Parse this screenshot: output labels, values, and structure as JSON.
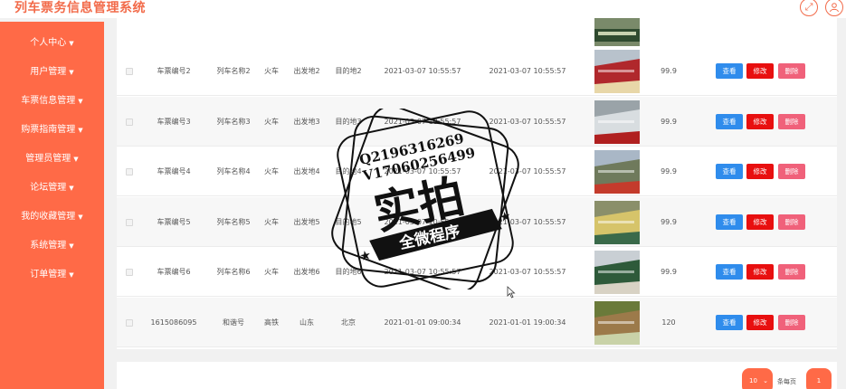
{
  "app": {
    "title": "列车票务信息管理系统"
  },
  "topbar_icons": [
    "fullscreen-icon",
    "user-icon"
  ],
  "sidebar": {
    "items": [
      {
        "label": "个人中心"
      },
      {
        "label": "用户管理"
      },
      {
        "label": "车票信息管理"
      },
      {
        "label": "购票指南管理"
      },
      {
        "label": "管理员管理"
      },
      {
        "label": "论坛管理"
      },
      {
        "label": "我的收藏管理"
      },
      {
        "label": "系统管理"
      },
      {
        "label": "订单管理"
      }
    ],
    "caret": "▼"
  },
  "table": {
    "rows": [
      {
        "code": "车票编号2",
        "name": "列车名称2",
        "type": "火车",
        "from": "出发地2",
        "to": "目的地2",
        "depart": "2021-03-07 10:55:57",
        "arrive": "2021-03-07 10:55:57",
        "price": "99.9"
      },
      {
        "code": "车票编号3",
        "name": "列车名称3",
        "type": "火车",
        "from": "出发地3",
        "to": "目的地3",
        "depart": "2021-03-07 10:55:57",
        "arrive": "2021-03-07 10:55:57",
        "price": "99.9"
      },
      {
        "code": "车票编号4",
        "name": "列车名称4",
        "type": "火车",
        "from": "出发地4",
        "to": "目的地4",
        "depart": "2021-03-07 10:55:57",
        "arrive": "2021-03-07 10:55:57",
        "price": "99.9"
      },
      {
        "code": "车票编号5",
        "name": "列车名称5",
        "type": "火车",
        "from": "出发地5",
        "to": "目的地5",
        "depart": "2021-03-07 10:55:57",
        "arrive": "2021-03-07 10:55:57",
        "price": "99.9"
      },
      {
        "code": "车票编号6",
        "name": "列车名称6",
        "type": "火车",
        "from": "出发地6",
        "to": "目的地6",
        "depart": "2021-03-07 10:55:57",
        "arrive": "2021-03-07 10:55:57",
        "price": "99.9"
      },
      {
        "code": "1615086095",
        "name": "和谐号",
        "type": "高铁",
        "from": "山东",
        "to": "北京",
        "depart": "2021-01-01 09:00:34",
        "arrive": "2021-01-01 19:00:34",
        "price": "120"
      }
    ],
    "actions": {
      "view": "查看",
      "edit": "修改",
      "delete": "删除"
    }
  },
  "pagination": {
    "page_size": "10",
    "page_size_label": "条每页",
    "current_page": "1"
  },
  "watermark": {
    "line1": "Q2196316269",
    "line2": "V17060256499",
    "main": "实拍",
    "ribbon": "全微程序"
  }
}
